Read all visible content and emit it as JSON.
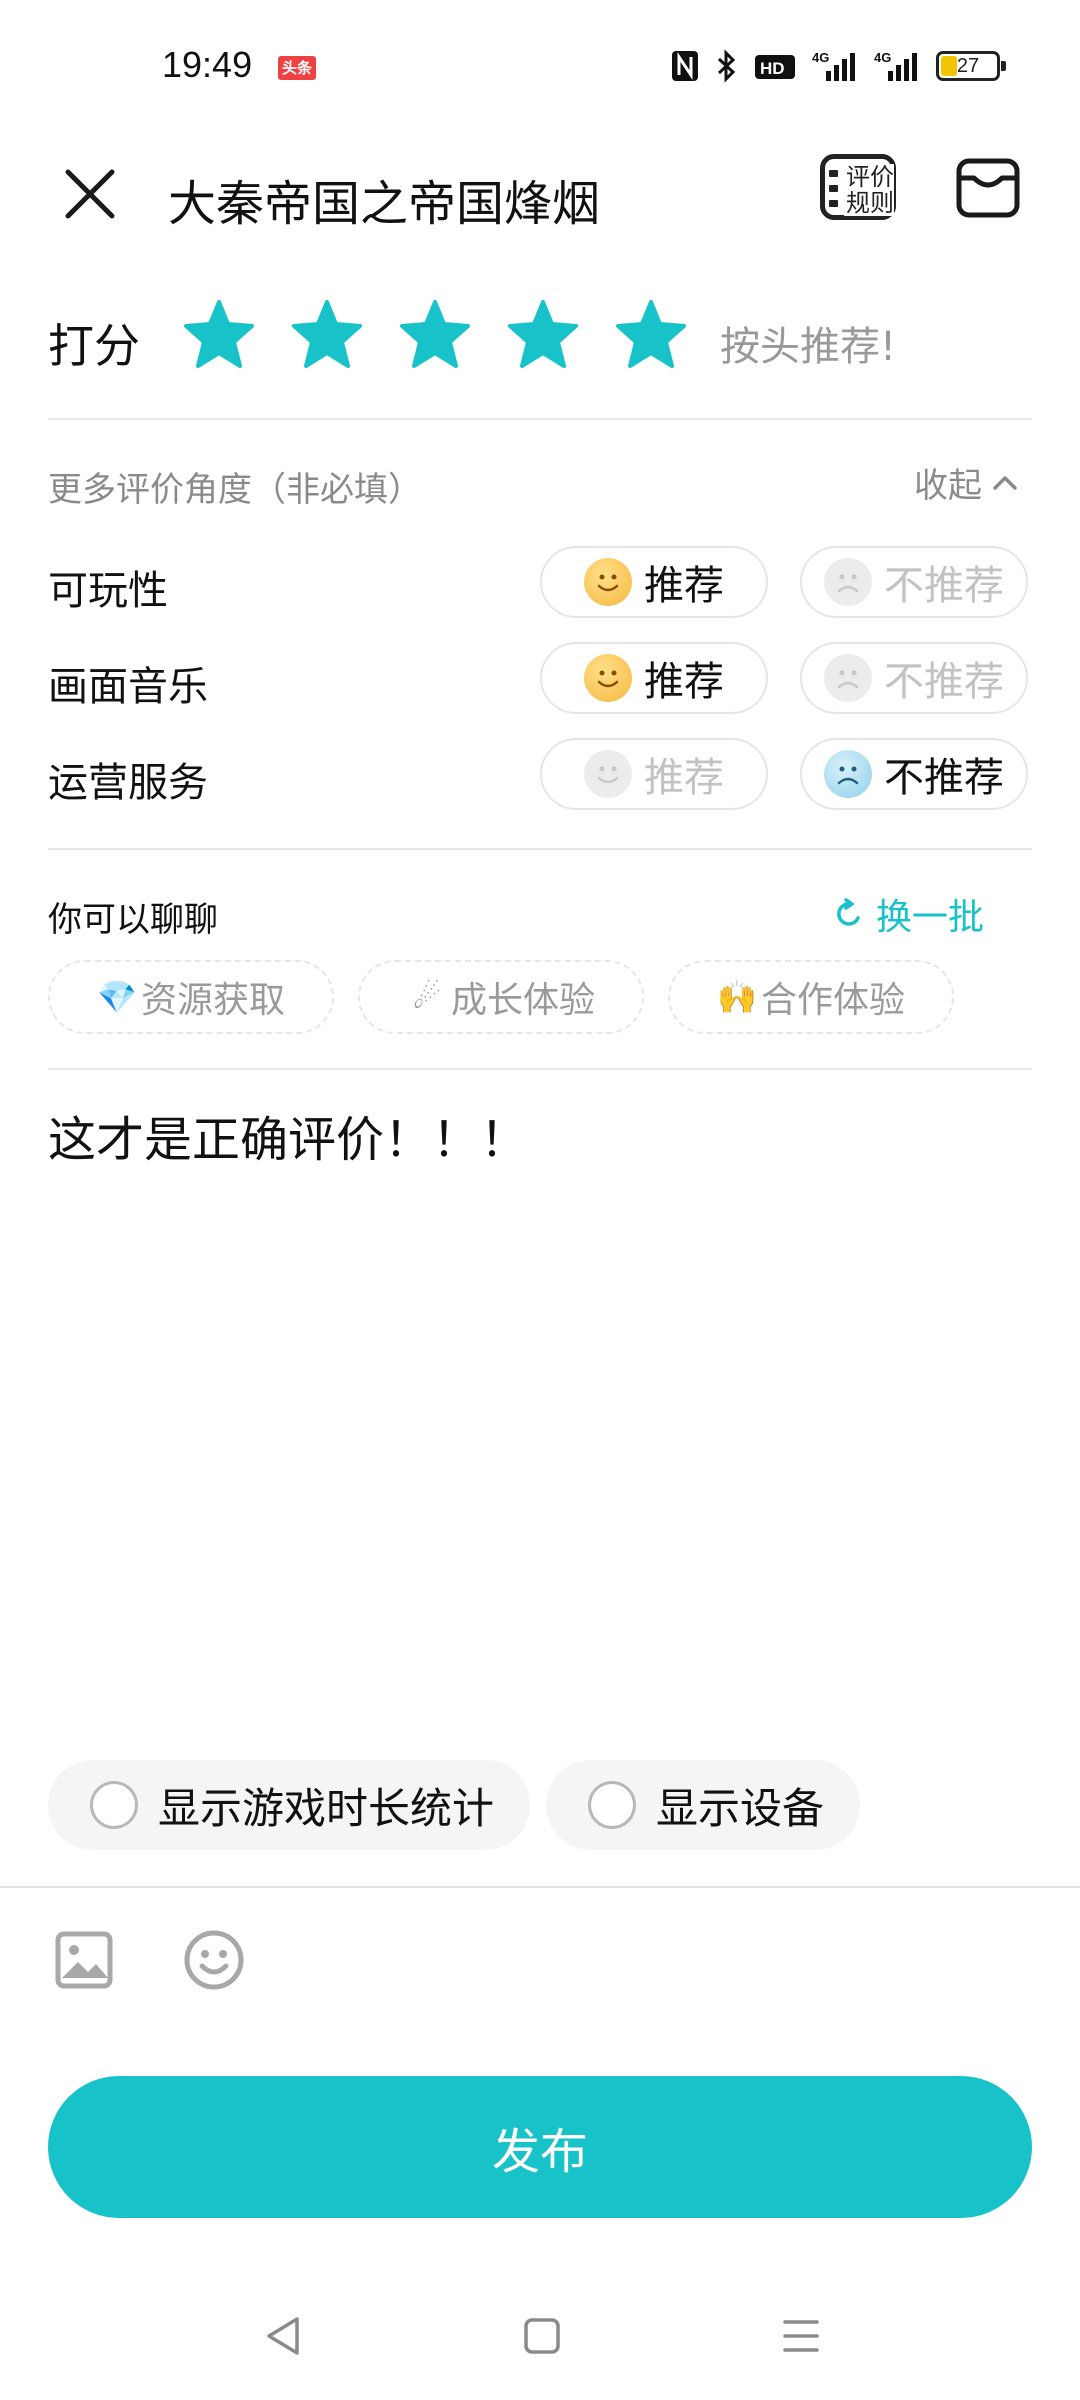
{
  "status_bar": {
    "time": "19:49",
    "badge": "头条",
    "hd_label": "HD",
    "signal1_label": "4G",
    "signal2_label": "4G",
    "battery": "27"
  },
  "header": {
    "title": "大秦帝国之帝国烽烟",
    "rules_label_line1": "评价",
    "rules_label_line2": "规则"
  },
  "rating": {
    "label": "打分",
    "stars": 5,
    "max_stars": 5,
    "hint": "按头推荐!"
  },
  "aspects": {
    "title": "更多评价角度（非必填）",
    "collapse_label": "收起",
    "recommend_label": "推荐",
    "not_recommend_label": "不推荐",
    "rows": [
      {
        "label": "可玩性",
        "selected": "recommend"
      },
      {
        "label": "画面音乐",
        "selected": "recommend"
      },
      {
        "label": "运营服务",
        "selected": "not_recommend"
      }
    ]
  },
  "chat": {
    "title": "你可以聊聊",
    "refresh_label": "换一批",
    "topics": [
      {
        "emoji": "💎",
        "label": "资源获取"
      },
      {
        "emoji": "☄",
        "label": "成长体验"
      },
      {
        "emoji": "🙌",
        "label": "合作体验"
      }
    ]
  },
  "review": {
    "text": "这才是正确评价！！！"
  },
  "options": {
    "show_playtime": "显示游戏时长统计",
    "show_device": "显示设备"
  },
  "publish_label": "发布",
  "colors": {
    "accent": "#17c3c9",
    "muted": "#8a8a8a"
  }
}
